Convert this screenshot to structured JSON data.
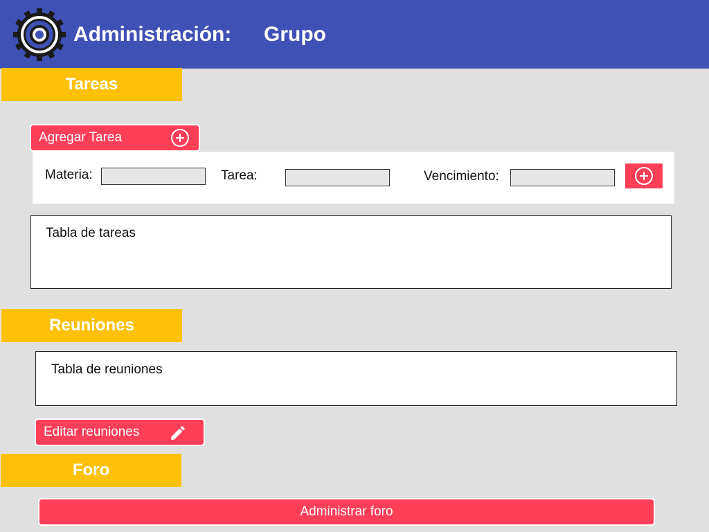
{
  "header": {
    "title": "Administración:",
    "group": "Grupo",
    "logo_icon": "gear-icon",
    "background": "#3f51b5"
  },
  "tasks": {
    "section_label": "Tareas",
    "add_button_label": "Agregar Tarea",
    "add_button_icon": "plus-circle-icon",
    "form": {
      "materia_label": "Materia:",
      "materia_value": "",
      "tarea_label": "Tarea:",
      "tarea_value": "",
      "vencimiento_label": "Vencimiento:",
      "vencimiento_value": "",
      "submit_icon": "plus-circle-icon"
    },
    "table_title": "Tabla de tareas"
  },
  "meetings": {
    "section_label": "Reuniones",
    "table_title": "Tabla de reuniones",
    "edit_button_label": "Editar reuniones",
    "edit_button_icon": "pencil-icon"
  },
  "forum": {
    "section_label": "Foro",
    "admin_button_label": "Administrar foro"
  },
  "colors": {
    "accent": "#ff3f58",
    "section_tab": "#ffc107",
    "page_background": "#e0e0e0"
  }
}
